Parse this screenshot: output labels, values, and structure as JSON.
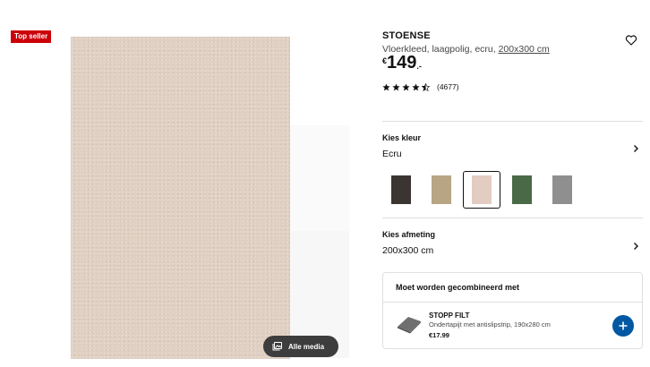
{
  "badge": {
    "label": "Top seller"
  },
  "gallery": {
    "media_button_label": "Alle media"
  },
  "product": {
    "name": "STOENSE",
    "description": "Vloerkleed, laagpolig, ecru, ",
    "size_link": "200x300 cm",
    "price_currency": "€",
    "price_amount": "149",
    "price_decimals": ".-",
    "rating_value": 4.5,
    "review_count": "(4677)"
  },
  "color_section": {
    "title": "Kies kleur",
    "selected": "Ecru",
    "swatches": [
      {
        "name": "dark-anthracite",
        "color": "#3b3532"
      },
      {
        "name": "beige",
        "color": "#b7a584"
      },
      {
        "name": "ecru",
        "color": "#e3ccc2",
        "selected": true
      },
      {
        "name": "green",
        "color": "#4a6a47"
      },
      {
        "name": "grey",
        "color": "#8f8f8f"
      }
    ]
  },
  "size_section": {
    "title": "Kies afmeting",
    "selected": "200x300 cm"
  },
  "combo": {
    "title": "Moet worden gecombineerd met",
    "item_name": "STOPP FILT",
    "item_description": "Ondertapijt met antislipstrip, 190x280 cm",
    "item_price": "€17.99"
  },
  "colors": {
    "badge_red": "#cc0008",
    "accent_blue": "#0058a3"
  }
}
